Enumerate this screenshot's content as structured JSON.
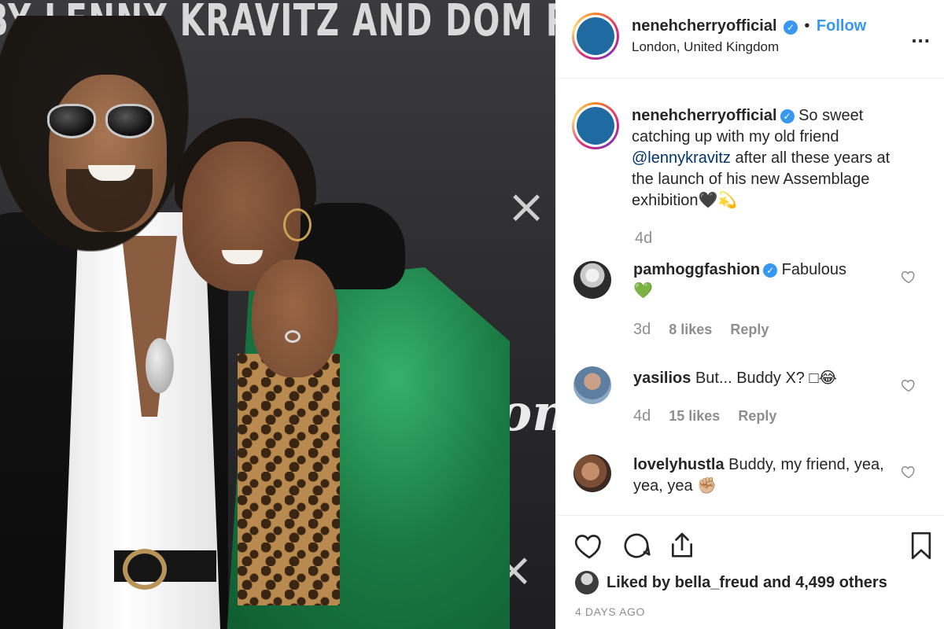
{
  "photo": {
    "backdrop_text": "BY LENNY KRAVITZ AND DOM PERIG",
    "backdrop_script": "Dom"
  },
  "header": {
    "username": "nenehcherryofficial",
    "verified_icon": "verified-badge-icon",
    "separator": "•",
    "follow_label": "Follow",
    "location": "London, United Kingdom",
    "more_label": "...",
    "accent_color": "#3897f0"
  },
  "caption": {
    "username": "nenehcherryofficial",
    "text_before": "So sweet catching up with my old friend",
    "mention": "@lennykravitz",
    "text_after": "after all these years at the launch of his new Assemblage exhibition",
    "emojis": "🖤💫",
    "time": "4d"
  },
  "comments": [
    {
      "username": "pamhoggfashion",
      "verified": true,
      "text": "Fabulous",
      "emoji": "💚",
      "time": "3d",
      "likes": "8 likes",
      "reply": "Reply"
    },
    {
      "username": "yasilios",
      "verified": false,
      "text": "But... Buddy X? □😂",
      "emoji": "",
      "time": "4d",
      "likes": "15 likes",
      "reply": "Reply"
    },
    {
      "username": "lovelyhustla",
      "verified": false,
      "text": "Buddy, my friend, yea, yea, yea",
      "emoji": "✊🏼",
      "time": "",
      "likes": "",
      "reply": ""
    }
  ],
  "actions": {
    "like_icon": "heart-icon",
    "comment_icon": "comment-icon",
    "share_icon": "share-icon",
    "save_icon": "bookmark-icon"
  },
  "likes": {
    "prefix": "Liked by",
    "user": "bella_freud",
    "middle": "and",
    "others": "4,499 others"
  },
  "date": "4 DAYS AGO"
}
